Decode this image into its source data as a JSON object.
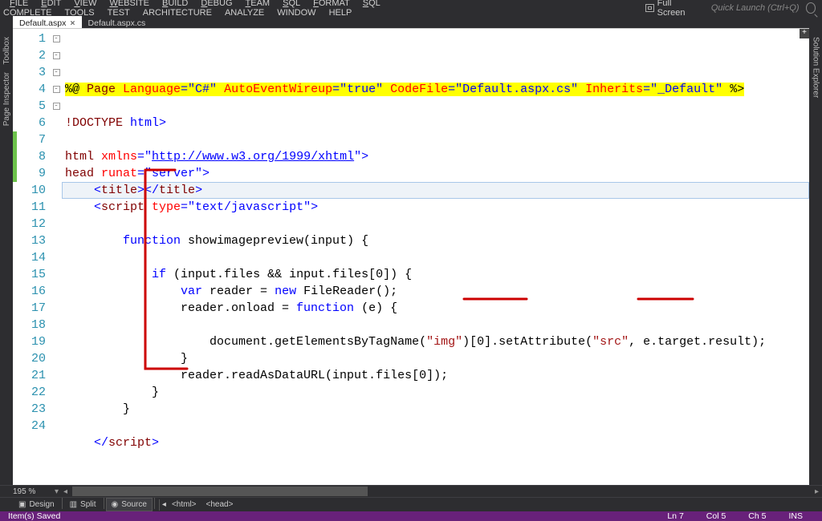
{
  "menu": {
    "items": [
      "FILE",
      "EDIT",
      "VIEW",
      "WEBSITE",
      "BUILD",
      "DEBUG",
      "TEAM",
      "SQL",
      "FORMAT",
      "SQL COMPLETE",
      "TOOLS",
      "TEST",
      "ARCHITECTURE",
      "ANALYZE",
      "WINDOW",
      "HELP"
    ],
    "fullscreen": "Full Screen",
    "quicklaunch": "Quick Launch (Ctrl+Q)"
  },
  "sidepanels": {
    "left": [
      "Toolbox",
      "Page Inspector"
    ],
    "right": "Solution Explorer"
  },
  "tabs": [
    {
      "label": "Default.aspx",
      "active": true
    },
    {
      "label": "Default.aspx.cs",
      "active": false
    }
  ],
  "editor": {
    "zoom": "195 %",
    "line_count": 24,
    "highlight_line": 7,
    "green_lines": [
      7,
      8,
      9
    ],
    "fold_lines": {
      "5": "-",
      "6": "-",
      "8": "-",
      "10": "-",
      "14": "-"
    },
    "lines": [
      {
        "n": 1,
        "seg": [
          {
            "t": "%@ ",
            "c": "tok-dir"
          },
          {
            "t": "Page ",
            "c": "tok-dir tok-mar"
          },
          {
            "t": "Language",
            "c": "tok-dir tok-attr"
          },
          {
            "t": "=\"C#\" ",
            "c": "tok-dir tok-str"
          },
          {
            "t": "AutoEventWireup",
            "c": "tok-dir tok-attr"
          },
          {
            "t": "=\"true\" ",
            "c": "tok-dir tok-str"
          },
          {
            "t": "CodeFile",
            "c": "tok-dir tok-attr"
          },
          {
            "t": "=\"Default.aspx.cs\" ",
            "c": "tok-dir tok-str"
          },
          {
            "t": "Inherits",
            "c": "tok-dir tok-attr"
          },
          {
            "t": "=\"_Default\" ",
            "c": "tok-dir tok-str"
          },
          {
            "t": "%>",
            "c": "tok-dir"
          }
        ]
      },
      {
        "n": 2,
        "seg": []
      },
      {
        "n": 3,
        "seg": [
          {
            "t": "!DOCTYPE ",
            "c": "tok-mar"
          },
          {
            "t": "html",
            "c": "tok-blue"
          },
          {
            "t": ">",
            "c": "tok-blue"
          }
        ]
      },
      {
        "n": 4,
        "seg": []
      },
      {
        "n": 5,
        "seg": [
          {
            "t": "html ",
            "c": "tok-mar"
          },
          {
            "t": "xmlns",
            "c": "tok-attr"
          },
          {
            "t": "=\"",
            "c": "tok-blue"
          },
          {
            "t": "http://www.w3.org/1999/xhtml",
            "c": "tok-link"
          },
          {
            "t": "\">",
            "c": "tok-blue"
          }
        ]
      },
      {
        "n": 6,
        "seg": [
          {
            "t": "head ",
            "c": "tok-mar"
          },
          {
            "t": "runat",
            "c": "tok-attr"
          },
          {
            "t": "=\"server\"",
            "c": "tok-blue"
          },
          {
            "t": ">",
            "c": "tok-blue"
          }
        ]
      },
      {
        "n": 7,
        "seg": [
          {
            "t": "    <",
            "c": "tok-blue"
          },
          {
            "t": "title",
            "c": "tok-mar"
          },
          {
            "t": "></",
            "c": "tok-blue"
          },
          {
            "t": "title",
            "c": "tok-mar"
          },
          {
            "t": ">",
            "c": "tok-blue"
          }
        ]
      },
      {
        "n": 8,
        "seg": [
          {
            "t": "    <",
            "c": "tok-blue"
          },
          {
            "t": "script ",
            "c": "tok-mar"
          },
          {
            "t": "type",
            "c": "tok-attr"
          },
          {
            "t": "=\"text/javascript\"",
            "c": "tok-blue"
          },
          {
            "t": ">",
            "c": "tok-blue"
          }
        ]
      },
      {
        "n": 9,
        "seg": []
      },
      {
        "n": 10,
        "seg": [
          {
            "t": "        ",
            "c": ""
          },
          {
            "t": "function",
            "c": "tok-kw"
          },
          {
            "t": " showimagepreview(input) {",
            "c": ""
          }
        ]
      },
      {
        "n": 11,
        "seg": []
      },
      {
        "n": 12,
        "seg": [
          {
            "t": "            ",
            "c": ""
          },
          {
            "t": "if",
            "c": "tok-kw"
          },
          {
            "t": " (input.files && input.files[0]) {",
            "c": ""
          }
        ]
      },
      {
        "n": 13,
        "seg": [
          {
            "t": "                ",
            "c": ""
          },
          {
            "t": "var",
            "c": "tok-kw"
          },
          {
            "t": " reader = ",
            "c": ""
          },
          {
            "t": "new",
            "c": "tok-kw"
          },
          {
            "t": " FileReader();",
            "c": ""
          }
        ]
      },
      {
        "n": 14,
        "seg": [
          {
            "t": "                reader.onload = ",
            "c": ""
          },
          {
            "t": "function",
            "c": "tok-kw"
          },
          {
            "t": " (e) {",
            "c": ""
          }
        ]
      },
      {
        "n": 15,
        "seg": []
      },
      {
        "n": 16,
        "seg": [
          {
            "t": "                    document.getElementsByTagName(",
            "c": ""
          },
          {
            "t": "\"img\"",
            "c": "tok-brown"
          },
          {
            "t": ")[0].setAttribute(",
            "c": ""
          },
          {
            "t": "\"src\"",
            "c": "tok-brown"
          },
          {
            "t": ", e.target.result);",
            "c": ""
          }
        ]
      },
      {
        "n": 17,
        "seg": [
          {
            "t": "                }",
            "c": ""
          }
        ]
      },
      {
        "n": 18,
        "seg": [
          {
            "t": "                reader.readAsDataURL(input.files[0]);",
            "c": ""
          }
        ]
      },
      {
        "n": 19,
        "seg": [
          {
            "t": "            }",
            "c": ""
          }
        ]
      },
      {
        "n": 20,
        "seg": [
          {
            "t": "        }",
            "c": ""
          }
        ]
      },
      {
        "n": 21,
        "seg": []
      },
      {
        "n": 22,
        "seg": [
          {
            "t": "    </",
            "c": "tok-blue"
          },
          {
            "t": "script",
            "c": "tok-mar"
          },
          {
            "t": ">",
            "c": "tok-blue"
          }
        ]
      },
      {
        "n": 23,
        "seg": []
      },
      {
        "n": 24,
        "seg": []
      }
    ]
  },
  "viewbar": {
    "buttons": [
      {
        "label": "Design",
        "icon": "▣"
      },
      {
        "label": "Split",
        "icon": "▥"
      },
      {
        "label": "Source",
        "icon": "◉",
        "active": true
      }
    ],
    "breadcrumbs": [
      "<html>",
      "<head>"
    ]
  },
  "status": {
    "left": "Item(s) Saved",
    "line": "Ln 7",
    "col": "Col 5",
    "ch": "Ch 5",
    "ins": "INS"
  }
}
